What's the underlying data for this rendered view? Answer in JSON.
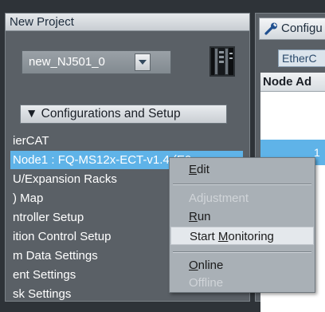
{
  "project_panel": {
    "title": "New Project",
    "device_dropdown": {
      "selected": "new_NJ501_0"
    },
    "tree": {
      "section_header": "Configurations and Setup",
      "section_arrow": "▼",
      "items": [
        "ierCAT",
        "Node1 : FQ-MS12x-ECT-v1.4 (E0",
        "U/Expansion Racks",
        ") Map",
        "ntroller Setup",
        "ition Control Setup",
        "m Data Settings",
        "ent Settings",
        "sk Settings"
      ]
    }
  },
  "config_panel": {
    "tab_label": "Configu",
    "subtab_label": "EtherC",
    "column_header": "Node Ad",
    "selected_row_value": "1"
  },
  "context_menu": {
    "items": {
      "edit": {
        "label_underlined": "E",
        "label_rest": "dit",
        "enabled": true
      },
      "adjustment": {
        "label": "Adjustment",
        "enabled": false
      },
      "run": {
        "label_underlined": "R",
        "label_rest": "un",
        "enabled": true
      },
      "start_monitoring": {
        "label_prefix": "Start ",
        "label_underlined": "M",
        "label_rest": "onitoring",
        "enabled": true,
        "highlighted": true
      },
      "online": {
        "label_underlined": "O",
        "label_rest": "nline",
        "enabled": true
      },
      "offline": {
        "label": "Offline",
        "enabled": false
      }
    }
  },
  "colors": {
    "selection": "#5fb3e8",
    "panel_bg": "#5a6066",
    "menu_bg": "#a9b0b6"
  },
  "icons": [
    "controller-icon",
    "wrench-icon",
    "dropdown-arrow-icon"
  ]
}
